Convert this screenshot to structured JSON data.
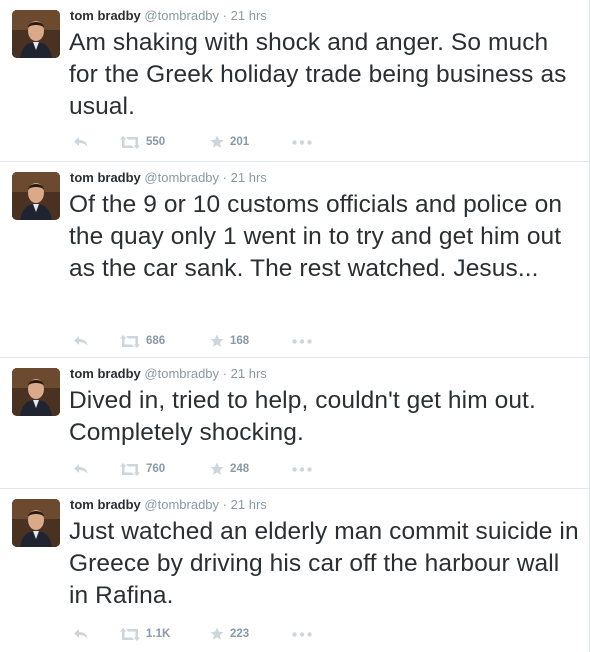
{
  "colors": {
    "text": "#292f33",
    "secondary": "#8899a6",
    "icon": "#ccd6dd",
    "divider": "#e1e8ed"
  },
  "tweets": [
    {
      "fullname": "tom bradby",
      "username": "@tombradby",
      "separator": "·",
      "time": "21 hrs",
      "text": "Am shaking with shock and anger. So much for the Greek holiday trade being business as usual.",
      "retweets": "550",
      "favorites": "201"
    },
    {
      "fullname": "tom bradby",
      "username": "@tombradby",
      "separator": "·",
      "time": "21 hrs",
      "text": "Of the 9 or 10 customs officials and police on the quay only 1 went in to try and get him out as the car sank. The rest watched. Jesus...",
      "retweets": "686",
      "favorites": "168"
    },
    {
      "fullname": "tom bradby",
      "username": "@tombradby",
      "separator": "·",
      "time": "21 hrs",
      "text": "Dived in, tried to help, couldn't get him out. Completely shocking.",
      "retweets": "760",
      "favorites": "248"
    },
    {
      "fullname": "tom bradby",
      "username": "@tombradby",
      "separator": "·",
      "time": "21 hrs",
      "text": "Just watched an elderly man commit suicide in Greece by driving his car off the harbour wall in Rafina.",
      "retweets": "1.1K",
      "favorites": "223"
    }
  ],
  "icons": {
    "reply": "reply-icon",
    "retweet": "retweet-icon",
    "favorite": "star-icon",
    "more": "more-dots-icon"
  }
}
